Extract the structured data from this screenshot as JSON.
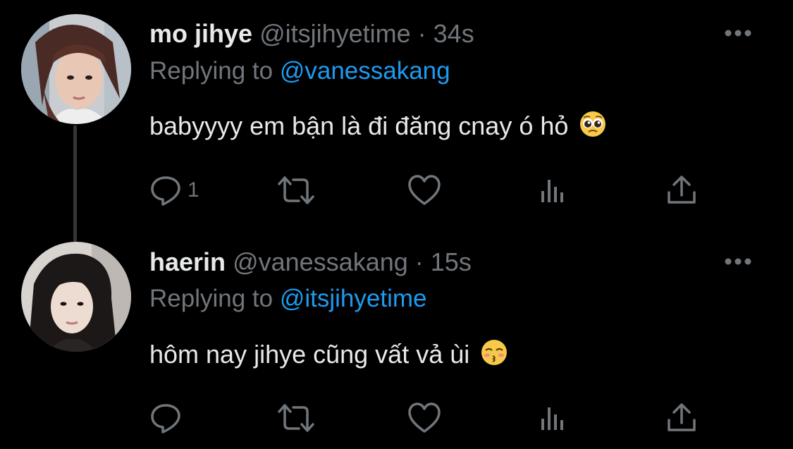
{
  "tweets": [
    {
      "display_name": "mo jihye",
      "handle": "@itsjihyetime",
      "time": "· 34s",
      "replying_prefix": "Replying to ",
      "replying_to": "@vanessakang",
      "text": "babyyyy em bận là đi đăng cnay ó hỏ",
      "emoji": "pleading-face-emoji",
      "reply_count": "1"
    },
    {
      "display_name": "haerin",
      "handle": "@vanessakang",
      "time": "· 15s",
      "replying_prefix": "Replying to ",
      "replying_to": "@itsjihyetime",
      "text": "hôm nay jihye cũng vất vả ùi",
      "emoji": "kissing-face-with-closed-eyes-emoji",
      "reply_count": ""
    }
  ],
  "icons": {
    "reply": "reply-icon",
    "retweet": "retweet-icon",
    "like": "like-icon",
    "views": "views-icon",
    "share": "share-icon",
    "more": "more-icon"
  },
  "colors": {
    "background": "#000000",
    "primary_text": "#e7e9ea",
    "secondary_text": "#71767b",
    "accent": "#1d9bf0",
    "thread_line": "#333639"
  }
}
